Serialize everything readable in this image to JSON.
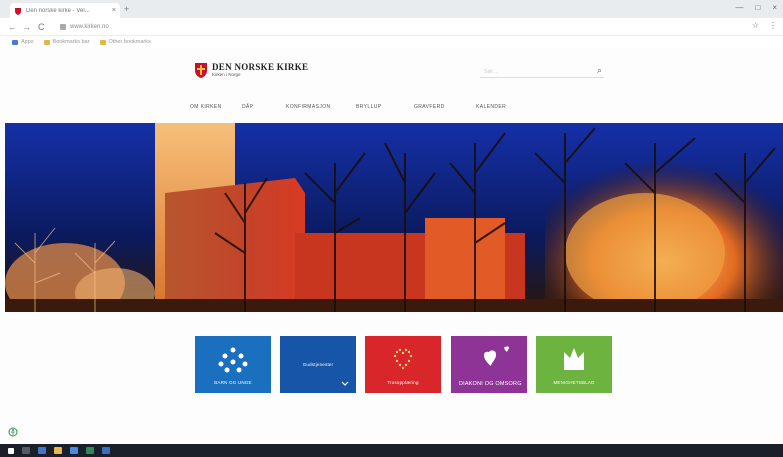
{
  "browser": {
    "tab_title": "Den norske kirke - Vel...",
    "tab_close": "×",
    "new_tab": "+",
    "url": "www.kirken.no",
    "back": "←",
    "forward": "→",
    "reload": "C",
    "window_controls": [
      "—",
      "□",
      "×"
    ],
    "toolbar_icons": [
      "☆",
      "⋮"
    ],
    "bookmarks": [
      "Apps",
      "Bookmarks bar",
      "Other bookmarks"
    ]
  },
  "site": {
    "logo_name": "DEN NORSKE KIRKE",
    "logo_tagline": "Kirken i Norge",
    "search_placeholder": "Søk ...",
    "search_icon": "⌕",
    "nav": [
      "Om kirken",
      "Dåp",
      "Konfirmasjon",
      "Bryllup",
      "Gravferd",
      "Kalender"
    ]
  },
  "tiles": [
    {
      "label": "Barn og unge",
      "color": "#1a6fbf",
      "icon": "people-network-icon"
    },
    {
      "label": "Gudstjenester",
      "color": "#1755a8",
      "icon": "chevron-down-icon"
    },
    {
      "label": "Trosopplæring",
      "color": "#d9262b",
      "icon": "heart-dots-icon"
    },
    {
      "label": "Diakoni og omsorg",
      "color": "#8e3496",
      "icon": "hearts-icon"
    },
    {
      "label": "Menighetsblad",
      "color": "#6db33f",
      "icon": "book-icon"
    }
  ],
  "colors": {
    "accent_red": "#c8102e",
    "hero_sky": "#0f1f6a",
    "taskbar": "#1b1f2a"
  }
}
